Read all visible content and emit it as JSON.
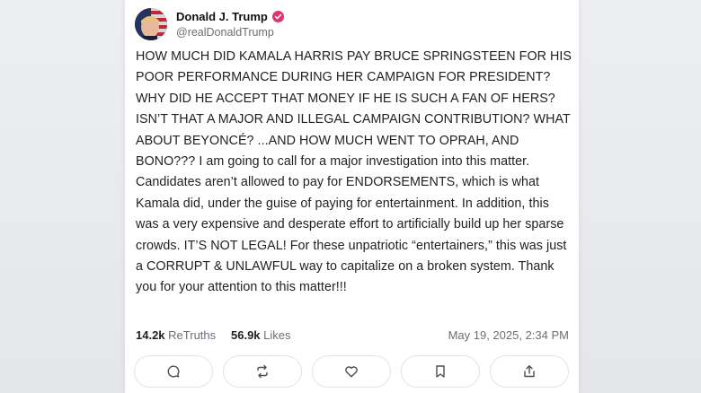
{
  "post": {
    "author": {
      "display_name": "Donald J. Trump",
      "handle": "@realDonaldTrump",
      "verified_icon": "verified-badge-icon",
      "verified_color": "#e0336f"
    },
    "body": "HOW MUCH DID KAMALA HARRIS PAY BRUCE SPRINGSTEEN FOR HIS POOR PERFORMANCE DURING HER CAMPAIGN FOR PRESIDENT? WHY DID HE ACCEPT THAT MONEY IF HE IS SUCH A FAN OF HERS? ISN’T THAT A MAJOR AND ILLEGAL CAMPAIGN CONTRIBUTION? WHAT ABOUT BEYONCÉ? ...AND HOW MUCH WENT TO OPRAH, AND BONO??? I am going to call for a major investigation into this matter. Candidates aren’t allowed to pay for ENDORSEMENTS, which is what Kamala did, under the guise of paying for entertainment. In addition, this was a very expensive and desperate effort to artificially build up her sparse crowds. IT’S NOT LEGAL! For these unpatriotic “entertainers,” this was just a CORRUPT & UNLAWFUL way to capitalize on a broken system. Thank you for your attention to this matter!!!",
    "stats": {
      "retruths_count": "14.2k",
      "retruths_label": "ReTruths",
      "likes_count": "56.9k",
      "likes_label": "Likes",
      "timestamp": "May 19, 2025, 2:34 PM"
    },
    "actions": [
      {
        "icon": "reply-icon"
      },
      {
        "icon": "retruth-icon"
      },
      {
        "icon": "heart-icon"
      },
      {
        "icon": "bookmark-icon"
      },
      {
        "icon": "share-icon"
      }
    ]
  }
}
